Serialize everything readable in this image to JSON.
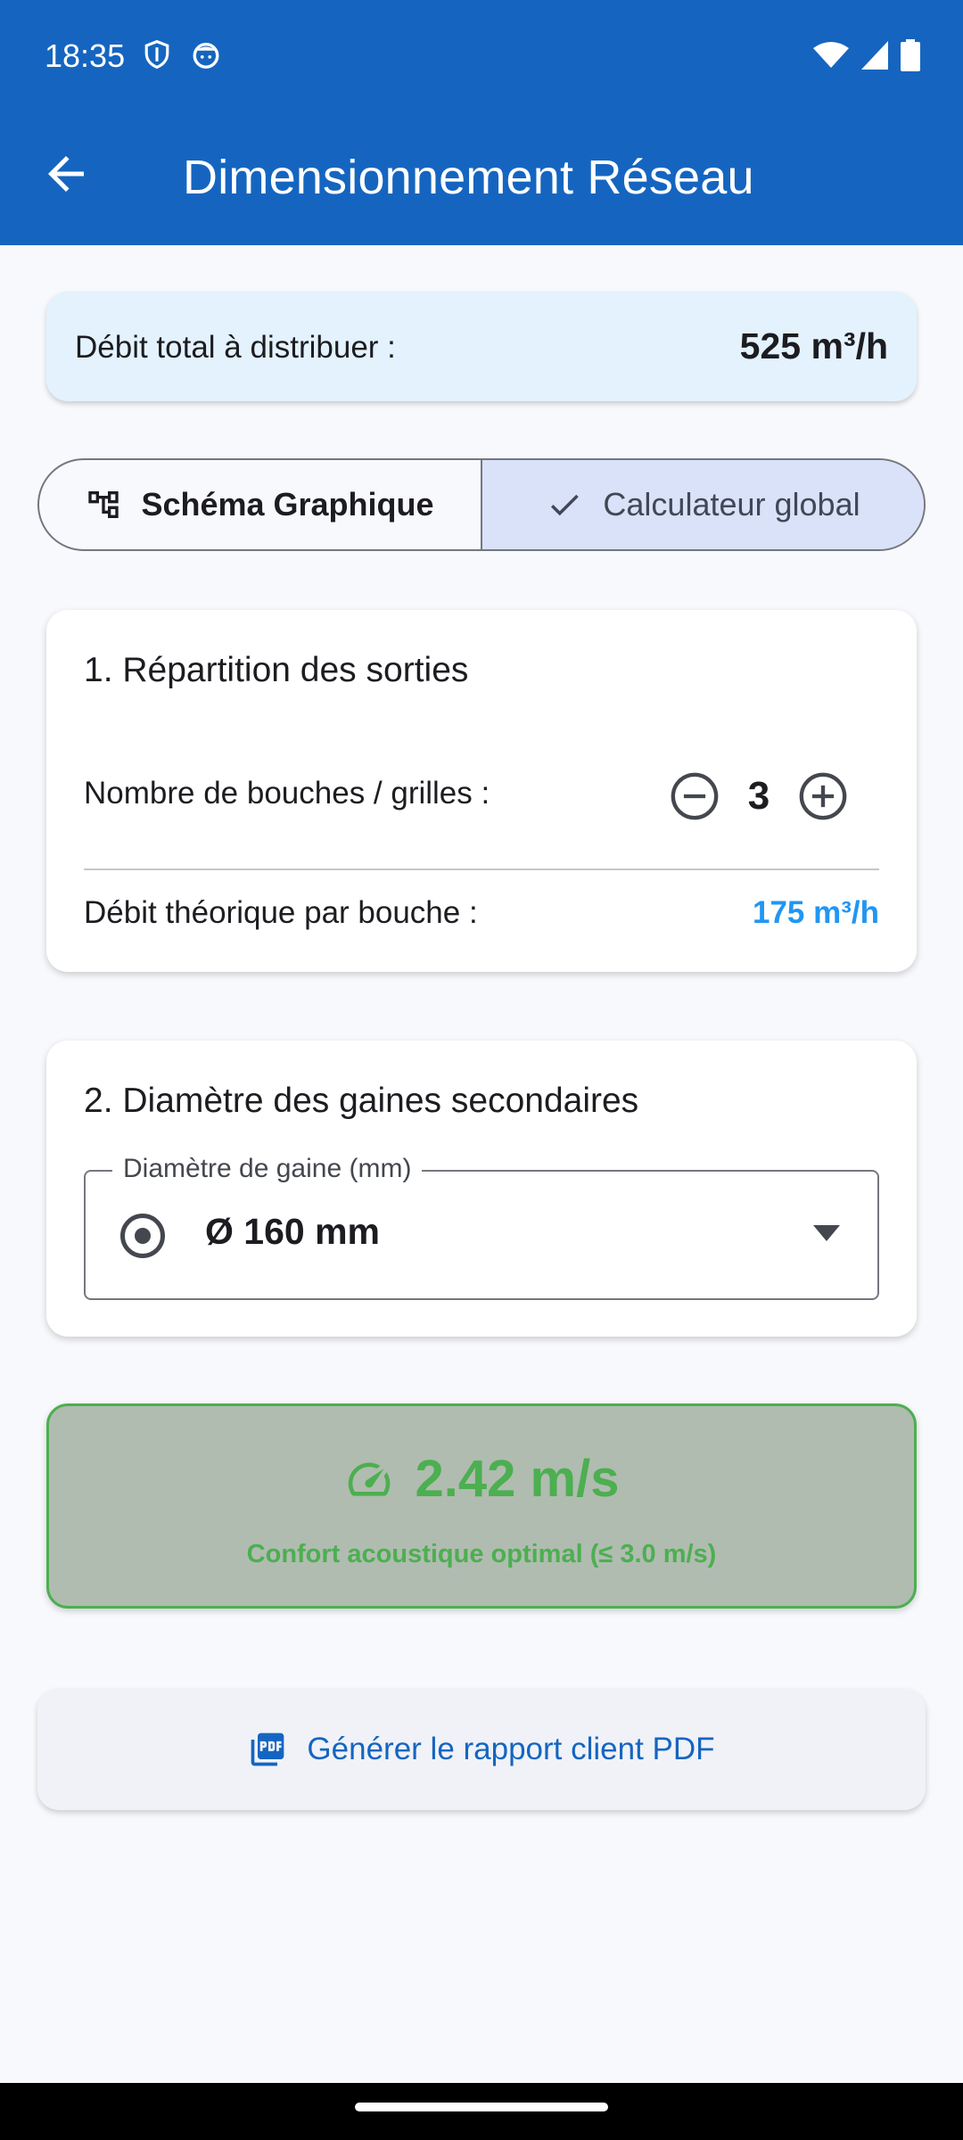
{
  "status_bar": {
    "time": "18:35",
    "left_icons": [
      "shield-icon",
      "face-icon"
    ],
    "right_icons": [
      "wifi-icon",
      "signal-icon",
      "battery-icon"
    ]
  },
  "app_bar": {
    "title": "Dimensionnement Réseau",
    "back_icon": "arrow-back-icon",
    "background": "#1565c0"
  },
  "total": {
    "label": "Débit total à distribuer :",
    "value": "525 m³/h"
  },
  "segmented": {
    "options": [
      {
        "label": "Schéma Graphique",
        "icon": "schema-icon",
        "selected": false
      },
      {
        "label": "Calculateur global",
        "icon": "check-icon",
        "selected": true
      }
    ]
  },
  "section1": {
    "title": "1. Répartition des sorties",
    "outlets_label": "Nombre de bouches / grilles :",
    "outlets_count": "3",
    "per_outlet_label": "Débit théorique par bouche :",
    "per_outlet_value": "175 m³/h"
  },
  "section2": {
    "title": "2. Diamètre des gaines secondaires",
    "field_label": "Diamètre de gaine (mm)",
    "field_value": "Ø 160 mm"
  },
  "velocity": {
    "value": "2.42 m/s",
    "status": "Confort acoustique optimal (≤ 3.0 m/s)",
    "color": "#4caf50"
  },
  "report": {
    "button_label": "Générer le rapport client PDF"
  }
}
